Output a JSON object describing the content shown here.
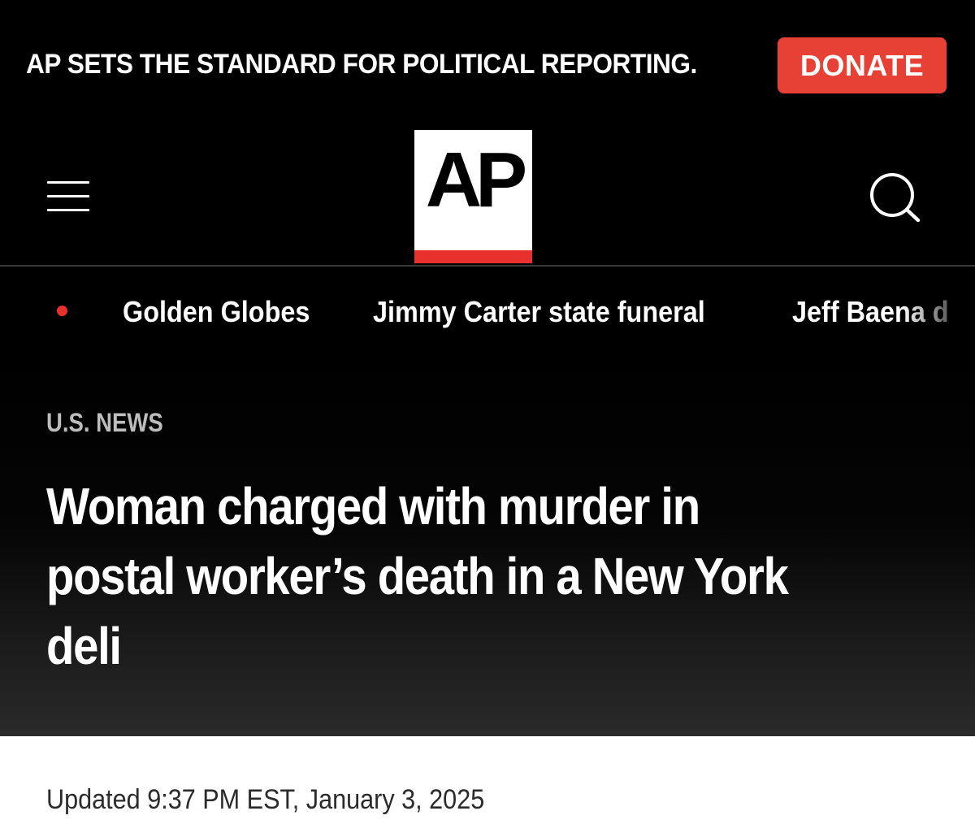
{
  "promo": {
    "text": "AP SETS THE STANDARD FOR POLITICAL REPORTING.",
    "donate_label": "DONATE"
  },
  "header": {
    "logo_text": "AP",
    "menu_icon": "hamburger-menu-icon",
    "search_icon": "search-icon"
  },
  "trending": {
    "items": [
      {
        "label": "Golden Globes"
      },
      {
        "label": "Jimmy Carter state funeral"
      },
      {
        "label": "Jeff Baena d"
      }
    ]
  },
  "article": {
    "section": "U.S. NEWS",
    "headline_lines": [
      "Woman charged with murder in",
      "postal worker’s death in a New York",
      "deli"
    ],
    "updated": "Updated 9:37 PM EST, January 3, 2025"
  },
  "colors": {
    "background": "#000000",
    "accent_red": "#e8302c",
    "donate_red": "#e74135"
  }
}
